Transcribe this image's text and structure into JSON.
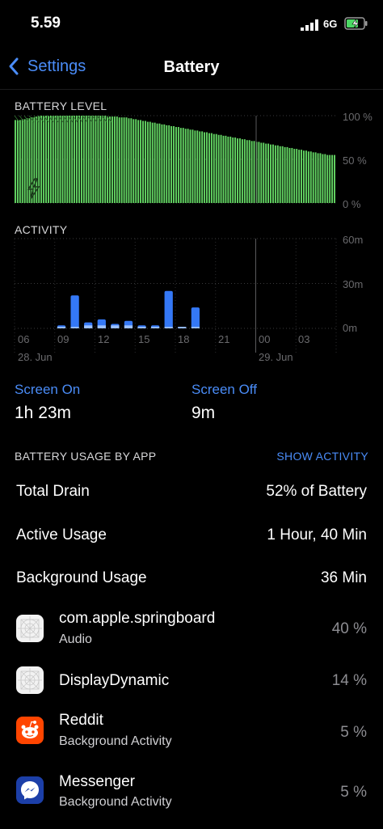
{
  "status_bar": {
    "time": "5.59",
    "network": "6G"
  },
  "nav": {
    "back_label": "Settings",
    "title": "Battery"
  },
  "battery_level": {
    "caption": "BATTERY LEVEL",
    "axis": [
      "100 %",
      "50 %",
      "0 %"
    ]
  },
  "activity": {
    "caption": "ACTIVITY",
    "axis": [
      "60m",
      "30m",
      "0m"
    ],
    "hours": [
      "06",
      "09",
      "12",
      "15",
      "18",
      "21",
      "00",
      "03"
    ],
    "dates": [
      "28. Jun",
      "29. Jun"
    ]
  },
  "chart_data": [
    {
      "type": "bar",
      "title": "BATTERY LEVEL",
      "ylabel": "",
      "ylim": [
        0,
        100
      ],
      "y_ticks": [
        "100 %",
        "50 %",
        "0 %"
      ],
      "x_labels": [],
      "charging_indicator": true,
      "values": [
        95,
        95,
        95,
        96,
        96,
        97,
        97,
        98,
        98,
        99,
        100,
        100,
        100,
        100,
        100,
        100,
        100,
        100,
        100,
        100,
        100,
        100,
        100,
        100,
        100,
        100,
        100,
        100,
        100,
        100,
        100,
        100,
        100,
        100,
        100,
        100,
        100,
        100,
        100,
        99,
        99,
        99,
        99,
        99,
        98,
        98,
        98,
        98,
        97,
        97,
        96,
        96,
        95,
        95,
        94,
        94,
        93,
        93,
        92,
        92,
        91,
        91,
        90,
        90,
        89,
        89,
        88,
        88,
        87,
        87,
        86,
        86,
        85,
        85,
        84,
        84,
        83,
        83,
        82,
        82,
        81,
        81,
        80,
        80,
        79,
        79,
        78,
        78,
        77,
        77,
        76,
        76,
        75,
        75,
        74,
        74,
        73,
        73,
        72,
        72,
        71,
        71,
        70,
        70,
        69,
        69,
        68,
        68,
        67,
        67,
        66,
        66,
        65,
        65,
        64,
        64,
        63,
        63,
        62,
        62,
        61,
        61,
        60,
        60,
        59,
        59,
        58,
        58,
        57,
        57,
        56,
        56,
        55,
        55,
        55,
        55
      ]
    },
    {
      "type": "bar",
      "title": "ACTIVITY",
      "ylabel": "",
      "ylim": [
        0,
        60
      ],
      "y_ticks": [
        "60m",
        "30m",
        "0m"
      ],
      "categories": [
        "06",
        "07",
        "08",
        "09",
        "10",
        "11",
        "12",
        "13",
        "14",
        "15",
        "16",
        "17",
        "18",
        "19",
        "20",
        "21",
        "22",
        "23",
        "00",
        "01",
        "02",
        "03",
        "04",
        "05"
      ],
      "series": [
        {
          "values": [
            0,
            0,
            0,
            2,
            22,
            4,
            6,
            3,
            5,
            2,
            2,
            25,
            1,
            14,
            0,
            0,
            0,
            0,
            0,
            0,
            0,
            0,
            0,
            0
          ]
        },
        {
          "values": [
            0,
            0,
            0,
            1,
            1,
            2,
            2,
            2,
            2,
            1,
            1,
            1,
            1,
            1,
            0,
            0,
            0,
            0,
            0,
            0,
            0,
            0,
            0,
            0
          ]
        }
      ]
    }
  ],
  "screen": {
    "on_label": "Screen On",
    "on_value": "1h 23m",
    "off_label": "Screen Off",
    "off_value": "9m"
  },
  "usage": {
    "header": "BATTERY USAGE BY APP",
    "show_activity": "SHOW ACTIVITY",
    "rows": [
      {
        "label": "Total Drain",
        "value": "52% of Battery"
      },
      {
        "label": "Active Usage",
        "value": "1 Hour, 40 Min"
      },
      {
        "label": "Background Usage",
        "value": "36 Min"
      }
    ],
    "apps": [
      {
        "name": "com.apple.springboard",
        "sub": "Audio",
        "pct": "40 %",
        "icon": "placeholder-app-icon"
      },
      {
        "name": "DisplayDynamic",
        "sub": "",
        "pct": "14 %",
        "icon": "placeholder-app-icon"
      },
      {
        "name": "Reddit",
        "sub": "Background Activity",
        "pct": "5 %",
        "icon": "reddit-icon"
      },
      {
        "name": "Messenger",
        "sub": "Background Activity",
        "pct": "5 %",
        "icon": "messenger-icon"
      }
    ]
  },
  "colors": {
    "accent": "#4a8cf7",
    "battery": "#63d563",
    "activity": "#3478f6",
    "background": "#000000"
  }
}
